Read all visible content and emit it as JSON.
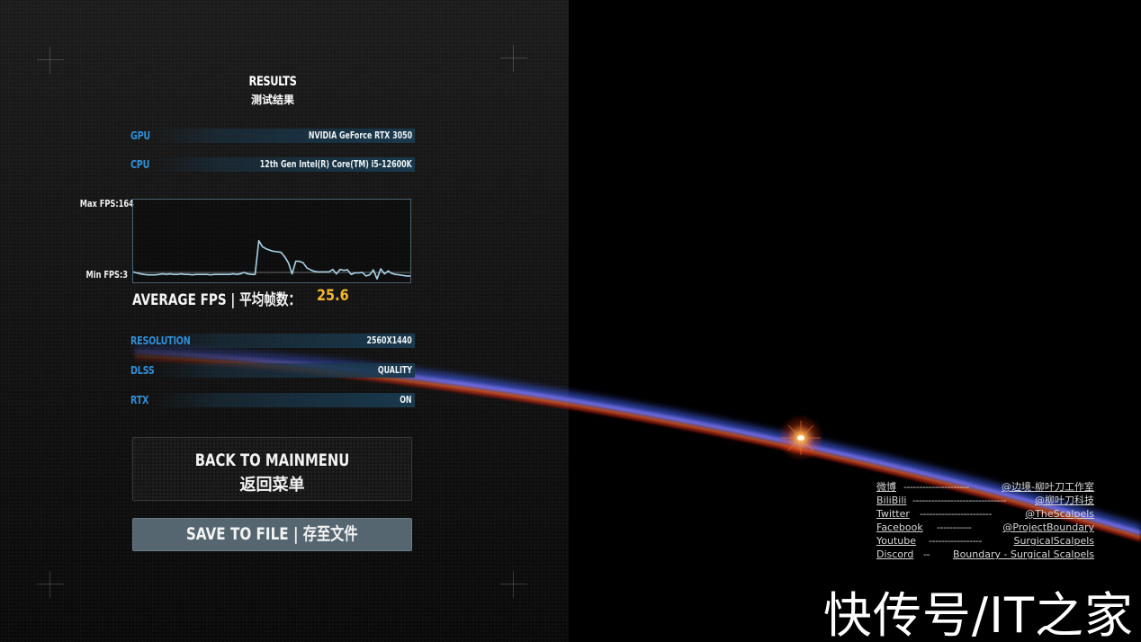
{
  "header": {
    "title_en": "RESULTS",
    "title_zh": "测试结果"
  },
  "hardware": [
    {
      "label": "GPU",
      "value": "NVIDIA GeForce RTX 3050"
    },
    {
      "label": "CPU",
      "value": "12th Gen Intel(R) Core(TM) i5-12600K"
    }
  ],
  "fps_graph": {
    "max_label": "Max FPS:164",
    "min_label": "Min FPS:3",
    "max_fps": 164,
    "min_fps": 3,
    "reference_line_fps": 21,
    "samples": [
      22,
      20,
      18,
      17,
      16,
      16,
      16,
      17,
      18,
      17,
      18,
      17,
      17,
      18,
      17,
      17,
      16,
      17,
      17,
      17,
      17,
      16,
      17,
      17,
      17,
      17,
      17,
      18,
      17,
      18,
      21,
      18,
      17,
      17,
      84,
      72,
      68,
      65,
      63,
      62,
      61,
      52,
      40,
      18,
      43,
      43,
      40,
      30,
      26,
      23,
      22,
      22,
      22,
      22,
      27,
      18,
      27,
      25,
      26,
      17,
      20,
      20,
      21,
      14,
      16,
      26,
      8,
      28,
      18,
      24,
      19,
      17,
      16,
      15,
      14,
      14
    ],
    "line_color": "#a9d3e8",
    "ref_line_color": "#6b6b6b"
  },
  "average": {
    "label": "AVERAGE FPS | 平均帧数：",
    "value": "25.6",
    "value_color": "#f5b731"
  },
  "settings": [
    {
      "label": "RESOLUTION",
      "value": "2560X1440"
    },
    {
      "label": "DLSS",
      "value": "QUALITY"
    },
    {
      "label": "RTX",
      "value": "ON"
    }
  ],
  "buttons": {
    "back_en": "BACK TO MAINMENU",
    "back_zh": "返回菜单",
    "save": "SAVE TO FILE | 存至文件"
  },
  "socials": [
    {
      "name": "微博",
      "dashes": "---------------------",
      "handle": "@边境-柳叶刀工作室"
    },
    {
      "name": "BiliBili",
      "dashes": "------------------------------",
      "handle": "@柳叶刀科技"
    },
    {
      "name": "Twitter",
      "dashes": "-----------------------",
      "handle": "@TheScalpels"
    },
    {
      "name": "Facebook",
      "dashes": "-----------",
      "handle": "@ProjectBoundary"
    },
    {
      "name": "Youtube",
      "dashes": "-----------------",
      "handle": "SurgicalScalpels"
    },
    {
      "name": "Discord",
      "dashes": "--",
      "handle": "Boundary - Surgical Scalpels"
    }
  ],
  "watermark": "快传号/IT之家",
  "colors": {
    "label_blue": "#2f8fd6",
    "accent_yellow": "#f5b731",
    "button_save_bg": "#556670"
  }
}
